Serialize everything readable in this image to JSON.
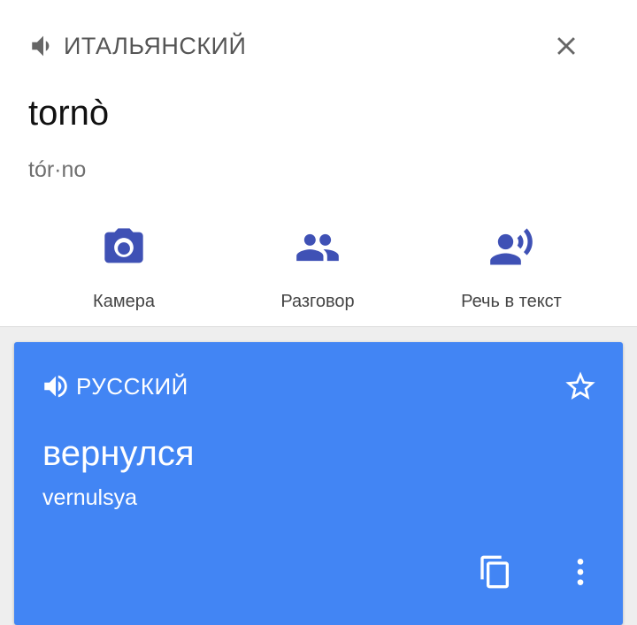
{
  "source": {
    "language": "ИТАЛЬЯНСКИЙ",
    "word": "tornò",
    "transliteration": "tór·no",
    "speaker_icon": "speaker-icon",
    "close_icon": "close-icon"
  },
  "actions": [
    {
      "label": "Камера",
      "icon": "camera-icon"
    },
    {
      "label": "Разговор",
      "icon": "conversation-icon"
    },
    {
      "label": "Речь в текст",
      "icon": "speech-to-text-icon"
    }
  ],
  "translation": {
    "language": "РУССКИЙ",
    "word": "вернулся",
    "transliteration": "vernulsya",
    "speaker_icon": "speaker-icon",
    "star_icon": "star-outline-icon",
    "copy_icon": "copy-icon",
    "more_icon": "more-vert-icon"
  },
  "colors": {
    "accent_blue": "#4285f4",
    "icon_indigo": "#3f51b5",
    "icon_gray": "#666666",
    "background": "#eeeeee"
  }
}
